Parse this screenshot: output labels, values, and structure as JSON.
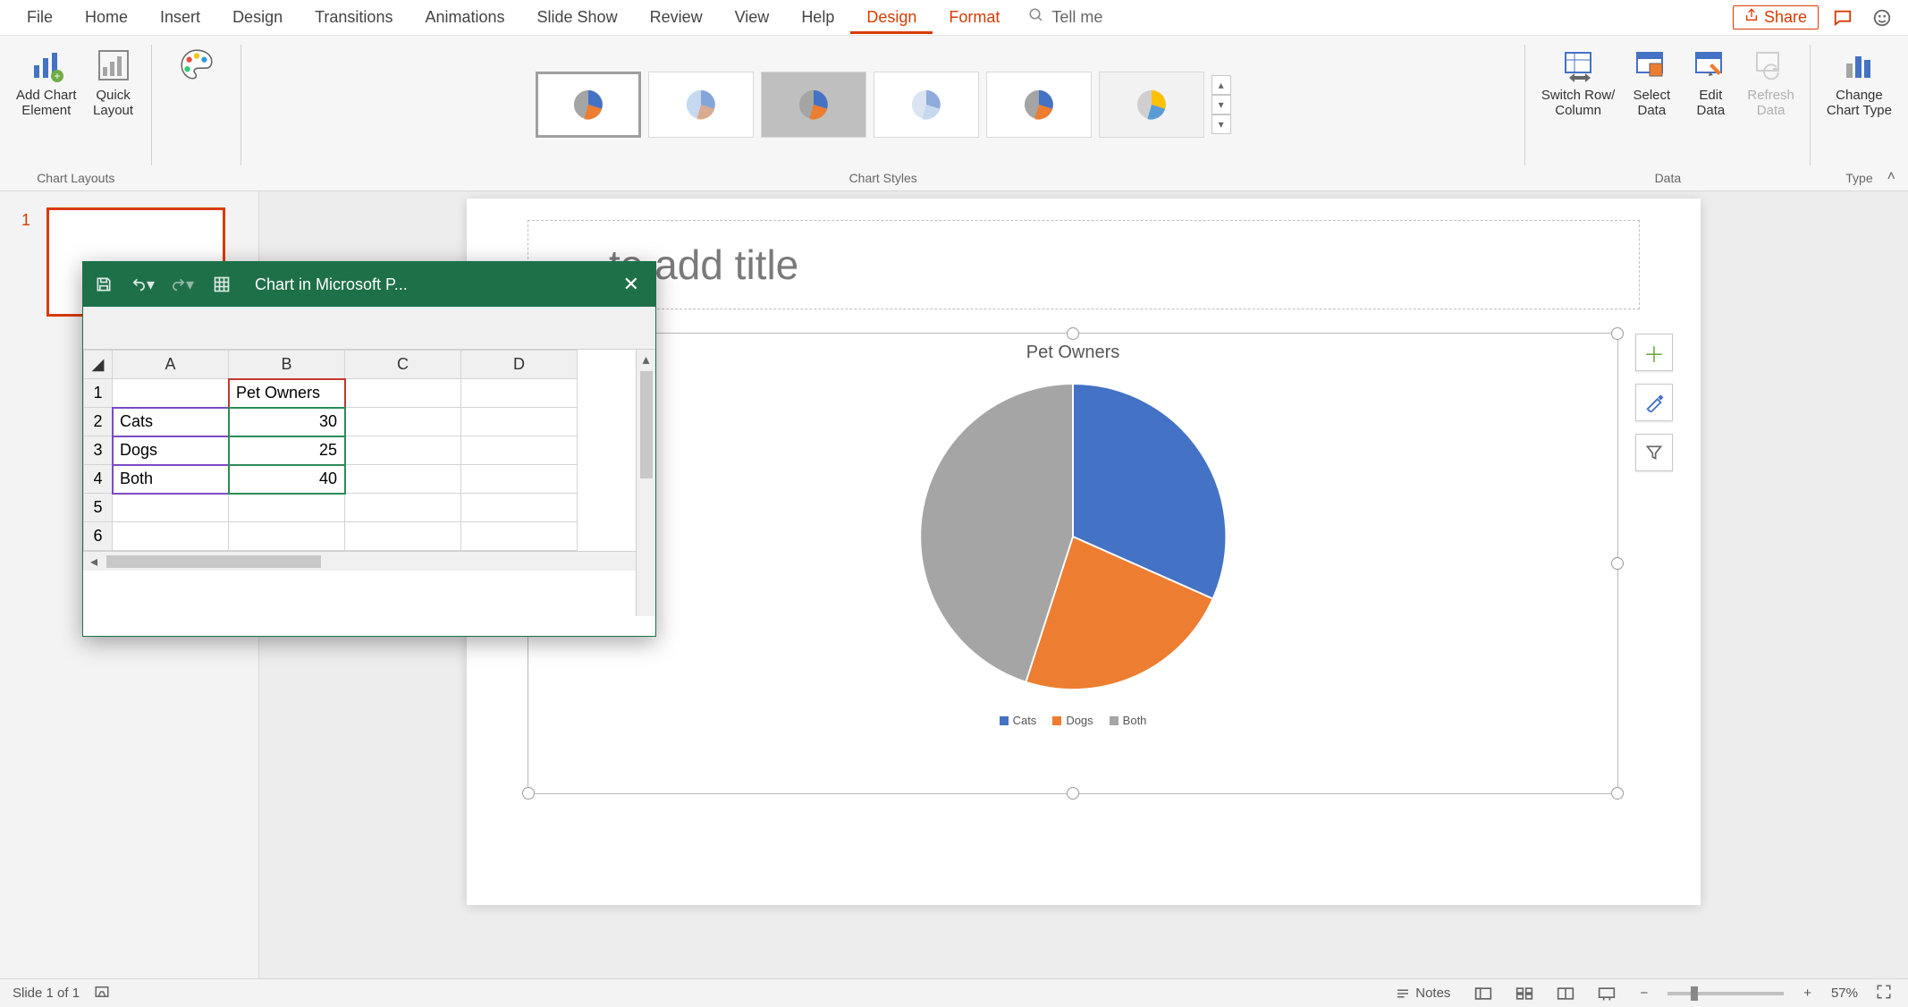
{
  "menu": {
    "items": [
      "File",
      "Home",
      "Insert",
      "Design",
      "Transitions",
      "Animations",
      "Slide Show",
      "Review",
      "View",
      "Help",
      "Design",
      "Format"
    ],
    "active_index": 10,
    "tellme": "Tell me",
    "share": "Share"
  },
  "ribbon": {
    "groups": {
      "chart_layouts": {
        "label": "Chart Layouts",
        "add_chart_element": "Add Chart\nElement",
        "quick_layout": "Quick\nLayout"
      },
      "change_colors": "Change\nColors",
      "chart_styles": {
        "label": "Chart Styles"
      },
      "data": {
        "label": "Data",
        "switch": "Switch Row/\nColumn",
        "select": "Select\nData",
        "edit": "Edit\nData",
        "refresh": "Refresh\nData"
      },
      "type": {
        "label": "Type",
        "change_type": "Change\nChart Type"
      }
    }
  },
  "slide": {
    "number": "1",
    "title_placeholder": "to add title"
  },
  "chart_data": {
    "type": "pie",
    "title": "Pet Owners",
    "categories": [
      "Cats",
      "Dogs",
      "Both"
    ],
    "values": [
      30,
      25,
      40
    ],
    "colors": [
      "#4472c4",
      "#ed7d31",
      "#a5a5a5"
    ],
    "legend_position": "bottom"
  },
  "excel_window": {
    "title": "Chart in Microsoft P...",
    "columns": [
      "A",
      "B",
      "C",
      "D"
    ],
    "rows": [
      {
        "n": "1",
        "a": "",
        "b": "Pet Owners",
        "c": "",
        "d": ""
      },
      {
        "n": "2",
        "a": "Cats",
        "b": "30",
        "c": "",
        "d": ""
      },
      {
        "n": "3",
        "a": "Dogs",
        "b": "25",
        "c": "",
        "d": ""
      },
      {
        "n": "4",
        "a": "Both",
        "b": "40",
        "c": "",
        "d": ""
      },
      {
        "n": "5",
        "a": "",
        "b": "",
        "c": "",
        "d": ""
      },
      {
        "n": "6",
        "a": "",
        "b": "",
        "c": "",
        "d": ""
      }
    ]
  },
  "status": {
    "slide_info": "Slide 1 of 1",
    "notes": "Notes",
    "zoom": "57%"
  }
}
